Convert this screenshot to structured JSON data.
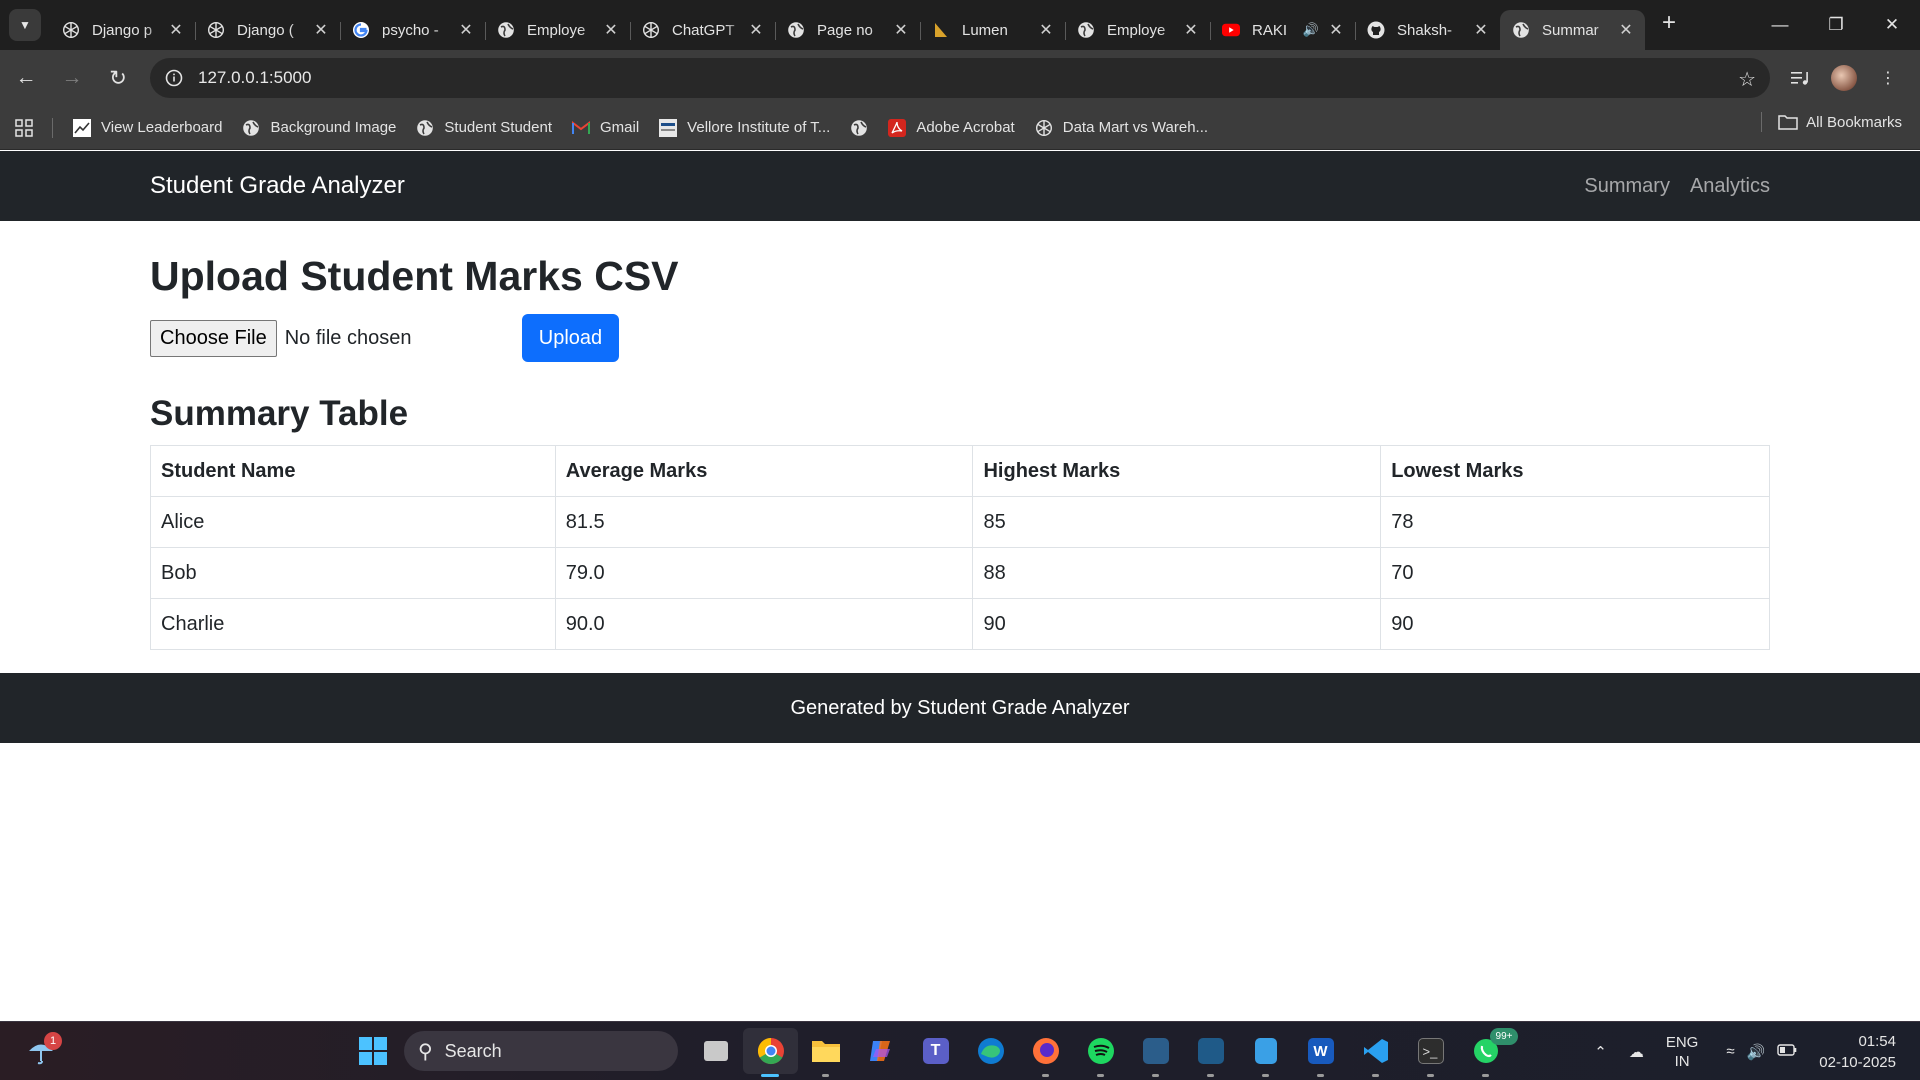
{
  "browser": {
    "tabs": [
      {
        "title": "Django p",
        "icon": "openai-icon"
      },
      {
        "title": "Django (",
        "icon": "openai-icon"
      },
      {
        "title": "psycho -",
        "icon": "google-icon"
      },
      {
        "title": "Employe",
        "icon": "globe-icon"
      },
      {
        "title": "ChatGPT",
        "icon": "openai-icon"
      },
      {
        "title": "Page no",
        "icon": "globe-icon"
      },
      {
        "title": "Lumen",
        "icon": "lumen-icon"
      },
      {
        "title": "Employe",
        "icon": "globe-icon"
      },
      {
        "title": "RAKI",
        "icon": "youtube-icon"
      },
      {
        "title": "Shaksh-",
        "icon": "github-icon"
      },
      {
        "title": "Summar",
        "icon": "globe-icon"
      }
    ],
    "active_tab_index": 10,
    "url": "127.0.0.1:5000",
    "bookmarks": [
      {
        "label": "View Leaderboard",
        "icon": "chart-icon"
      },
      {
        "label": "Background Image",
        "icon": "globe-icon"
      },
      {
        "label": "Student Student",
        "icon": "globe-icon"
      },
      {
        "label": "Gmail",
        "icon": "gmail-icon"
      },
      {
        "label": "Vellore Institute of T...",
        "icon": "vit-icon"
      },
      {
        "label": "",
        "icon": "globe-icon"
      },
      {
        "label": "Adobe Acrobat",
        "icon": "acrobat-icon"
      },
      {
        "label": "Data Mart vs Wareh...",
        "icon": "openai-icon"
      }
    ],
    "all_bookmarks": "All Bookmarks"
  },
  "app": {
    "brand": "Student Grade Analyzer",
    "nav": [
      "Summary",
      "Analytics"
    ],
    "upload_title": "Upload Student Marks CSV",
    "choose_file": "Choose File",
    "no_file": "No file chosen",
    "upload_button": "Upload",
    "summary_title": "Summary Table",
    "table": {
      "headers": [
        "Student Name",
        "Average Marks",
        "Highest Marks",
        "Lowest Marks"
      ],
      "rows": [
        [
          "Alice",
          "81.5",
          "85",
          "78"
        ],
        [
          "Bob",
          "79.0",
          "88",
          "70"
        ],
        [
          "Charlie",
          "90.0",
          "90",
          "90"
        ]
      ]
    },
    "footer": "Generated by Student Grade Analyzer"
  },
  "taskbar": {
    "weather_badge": "1",
    "search_placeholder": "Search",
    "whatsapp_badge": "99+",
    "lang_line1": "ENG",
    "lang_line2": "IN",
    "time": "01:54",
    "date": "02-10-2025"
  },
  "colors": {
    "navbar": "#212529",
    "primary_button": "#0d6efd",
    "chrome_frame": "#1f1f1f",
    "chrome_toolbar": "#3c3c3c"
  }
}
